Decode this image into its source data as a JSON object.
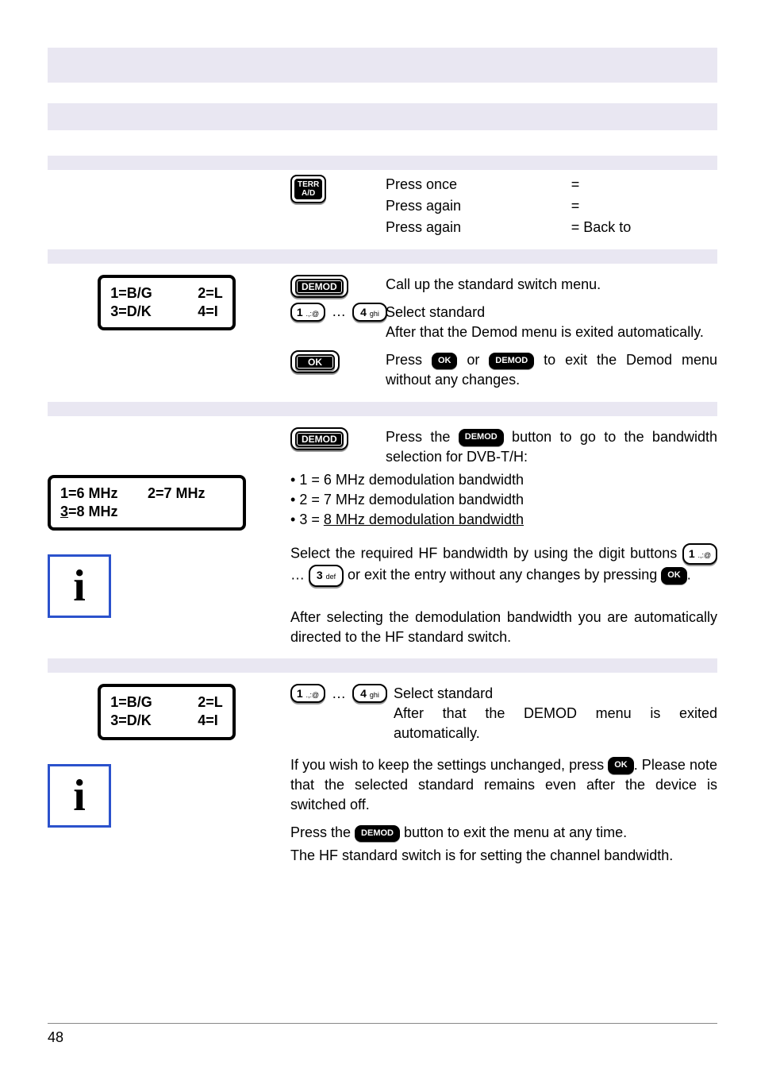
{
  "header_bands": {},
  "section1": {
    "terr_btn_line1": "TERR",
    "terr_btn_line2": "A/D",
    "press_once": "Press once",
    "eq1": "=",
    "press_again1": "Press again",
    "eq2": "=",
    "press_again2": "Press again",
    "eq3": "= Back to"
  },
  "section2": {
    "lcd": {
      "r1a": "1=B/G",
      "r1b": "2=L",
      "r2a": "3=D/K",
      "r2b": "4=I"
    },
    "btn_demod": "DEMOD",
    "text_callup": "Call up the standard switch menu.",
    "btn_1": "1",
    "btn_1_sub": ".,:@",
    "btn_4": "4",
    "btn_4_sub": "ghi",
    "text_select": "Select standard",
    "text_after": "After that the Demod menu is exited automatically.",
    "btn_ok": "OK",
    "text_press": "Press ",
    "inline_ok": "OK",
    "text_or": " or ",
    "inline_demod": "DEMOD",
    "text_exit": " to exit the Demod menu without any changes."
  },
  "section3": {
    "btn_demod": "DEMOD",
    "text_press_the": "Press the ",
    "inline_demod": "DEMOD",
    "text_goto": " button to go to the bandwidth selection for DVB-T/H:",
    "bullet1": "1 = 6 MHz demodulation bandwidth",
    "bullet2": "2 = 7 MHz demodulation bandwidth",
    "bullet3_prefix": "3 = ",
    "bullet3_underlined": "8 MHz demodulation bandwidth",
    "lcd": {
      "r1a": "1=6 MHz",
      "r1b": "2=7 MHz",
      "r2a_underlined": "3",
      "r2a_rest": "=8 MHz"
    },
    "text_select_req": "Select the required HF bandwidth by using the digit buttons ",
    "btn_1": "1",
    "btn_1_sub": ".,:@",
    "ellipsis": "…",
    "btn_3": "3",
    "btn_3_sub": "def",
    "text_orexit": " or exit the entry without any changes by pressing ",
    "inline_ok": "OK",
    "period": ".",
    "after_select": "After selecting the demodulation bandwidth you are automatically directed to the HF standard switch."
  },
  "section4": {
    "lcd": {
      "r1a": "1=B/G",
      "r1b": "2=L",
      "r2a": "3=D/K",
      "r2b": "4=I"
    },
    "btn_1": "1",
    "btn_1_sub": ".,:@",
    "btn_4": "4",
    "btn_4_sub": "ghi",
    "text_select": "Select standard",
    "text_after": "After that the DEMOD menu is exited automatically.",
    "text_keep_pre": "If you wish to keep the settings unchanged, press ",
    "inline_ok": "OK",
    "text_keep_post": ". Please note that the selected standard remains even after the device is switched off.",
    "text_pressthe": "Press the ",
    "inline_demod": "DEMOD",
    "text_exitmenu": " button to exit the menu at any time.",
    "text_hf": "The HF standard switch is for setting the channel bandwidth."
  },
  "page_number": "48"
}
